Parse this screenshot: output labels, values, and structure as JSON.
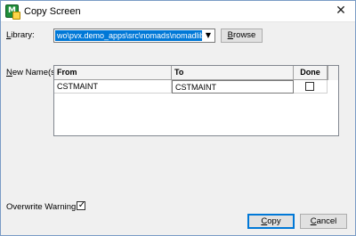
{
  "window": {
    "title": "Copy Screen",
    "app_icon_letter": "M",
    "close_glyph": "✕"
  },
  "library": {
    "label_prefix": "",
    "label_accel": "L",
    "label_rest": "ibrary:",
    "value": "wo\\pvx.demo_apps\\src\\nomads\\nomadlib.en",
    "dropdown_icon": "chevron-down-icon",
    "browse_accel": "B",
    "browse_rest": "rowse"
  },
  "new_names": {
    "label_accel": "N",
    "label_rest": "ew Name(s):",
    "columns": [
      "From",
      "To",
      "Done"
    ],
    "rows": [
      {
        "from": "CSTMAINT",
        "to": "CSTMAINT",
        "done": false
      }
    ]
  },
  "overwrite_warning": {
    "label": "Overwrite Warning",
    "checked": true,
    "check_glyph": "✓"
  },
  "buttons": {
    "copy_accel": "C",
    "copy_rest": "opy",
    "cancel_accel": "C",
    "cancel_rest": "ancel"
  },
  "colors": {
    "selection": "#0078d7",
    "dialog_bg": "#f0f0f0",
    "icon_green": "#1f8f3a"
  }
}
